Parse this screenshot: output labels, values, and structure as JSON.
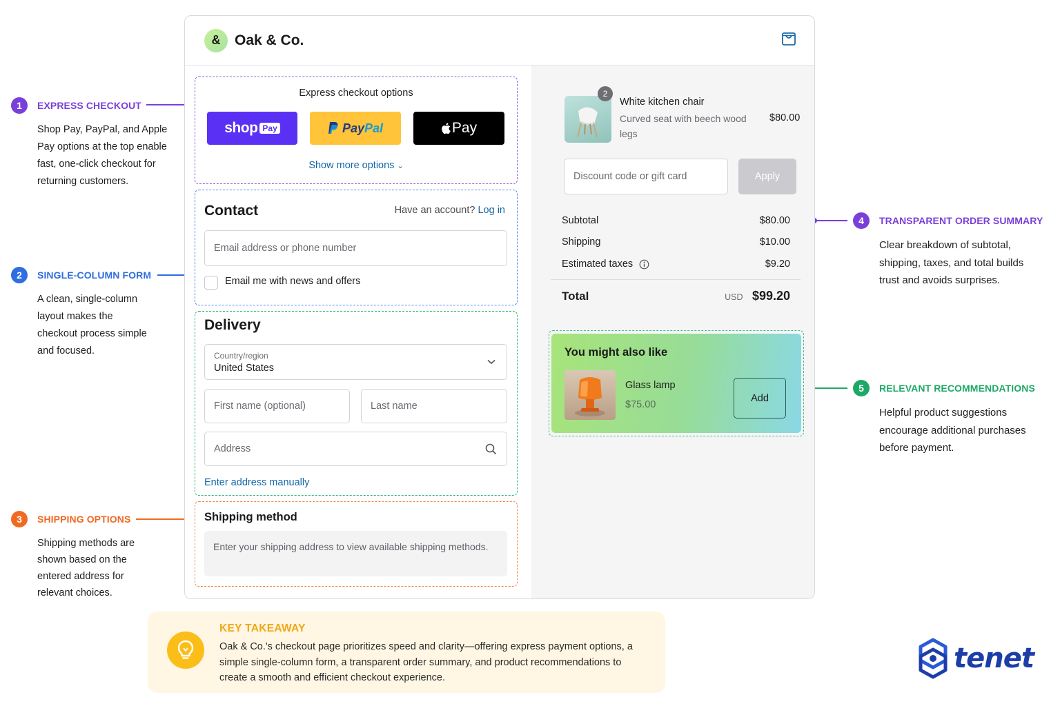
{
  "annotations": [
    {
      "num": "1",
      "title": "EXPRESS CHECKOUT",
      "color": "#7a3fd9",
      "body": "Shop Pay, PayPal, and Apple Pay options at the top enable fast, one-click checkout for returning customers."
    },
    {
      "num": "2",
      "title": "SINGLE-COLUMN FORM",
      "color": "#2f6de0",
      "body": "A clean, single-column layout makes the checkout process simple and focused."
    },
    {
      "num": "3",
      "title": "SHIPPING OPTIONS",
      "color": "#f06a22",
      "body": "Shipping methods are shown based on the entered address for relevant choices."
    },
    {
      "num": "4",
      "title": "TRANSPARENT ORDER SUMMARY",
      "color": "#7a3fd9",
      "body": "Clear breakdown of subtotal, shipping, taxes, and total builds trust and avoids surprises."
    },
    {
      "num": "5",
      "title": "RELEVANT RECOMMENDATIONS",
      "color": "#1ea866",
      "body": "Helpful product suggestions encourage additional purchases before payment."
    }
  ],
  "header": {
    "logo_symbol": "&",
    "brand": "Oak & Co.",
    "cart_icon": "shopping-bag-icon"
  },
  "express": {
    "title": "Express checkout options",
    "shop_pay": {
      "word": "shop",
      "badge": "Pay",
      "color": "#5a31f4"
    },
    "paypal": {
      "word_a": "Pay",
      "word_b": "Pal",
      "color": "#ffc439"
    },
    "apple_pay": {
      "logo": "",
      "word": "Pay",
      "color": "#000000"
    },
    "more": "Show more options"
  },
  "contact": {
    "title": "Contact",
    "have_account": "Have an account?",
    "login": "Log in",
    "email_placeholder": "Email address or phone number",
    "newsletter": "Email me with news and offers"
  },
  "delivery": {
    "title": "Delivery",
    "country_label": "Country/region",
    "country_value": "United States",
    "first_name": "First name (optional)",
    "last_name": "Last name",
    "address": "Address",
    "manual": "Enter address manually"
  },
  "shipping": {
    "title": "Shipping method",
    "note": "Enter your shipping address to view available shipping methods."
  },
  "order": {
    "item": {
      "qty": "2",
      "name": "White kitchen chair",
      "desc": "Curved seat with beech wood legs",
      "price": "$80.00"
    },
    "discount_placeholder": "Discount code or gift card",
    "apply": "Apply",
    "subtotal_label": "Subtotal",
    "subtotal": "$80.00",
    "shipping_label": "Shipping",
    "shipping": "$10.00",
    "taxes_label": "Estimated taxes",
    "taxes": "$9.20",
    "total_label": "Total",
    "currency": "USD",
    "total": "$99.20"
  },
  "recommend": {
    "title": "You might also like",
    "name": "Glass lamp",
    "price": "$75.00",
    "add": "Add"
  },
  "takeaway": {
    "title": "KEY TAKEAWAY",
    "body": "Oak & Co.'s checkout page prioritizes speed and clarity—offering express payment options, a simple single-column form, a transparent order summary, and product recommendations to create a smooth and efficient checkout experience."
  },
  "brand_logo": {
    "word": "tenet",
    "color": "#1d3ea8"
  }
}
